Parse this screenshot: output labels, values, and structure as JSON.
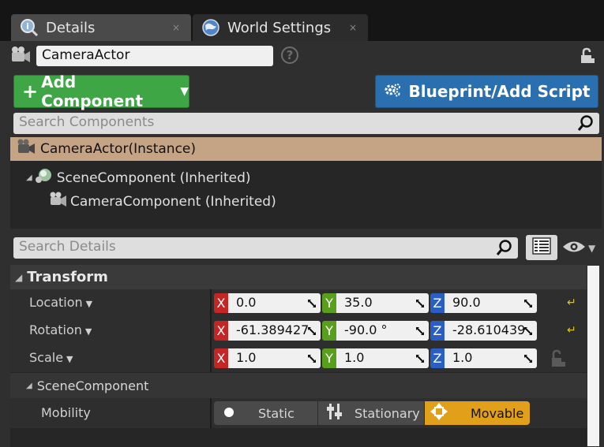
{
  "tabs": [
    {
      "label": "Details",
      "close": "×"
    },
    {
      "label": "World Settings",
      "close": "×"
    }
  ],
  "actor": {
    "name": "CameraActor",
    "help": "?"
  },
  "buttons": {
    "add_component": {
      "plus": "+",
      "label": "Add Component"
    },
    "blueprint": {
      "label": "Blueprint/Add Script"
    }
  },
  "search_components": {
    "placeholder": "Search Components"
  },
  "tree": {
    "root": "CameraActor(Instance)",
    "children": [
      {
        "label": "SceneComponent (Inherited)"
      },
      {
        "label": "CameraComponent (Inherited)"
      }
    ]
  },
  "search_details": {
    "placeholder": "Search Details"
  },
  "transform": {
    "title": "Transform",
    "rows": [
      {
        "label": "Location",
        "x": "0.0",
        "y": "35.0",
        "z": "90.0"
      },
      {
        "label": "Rotation",
        "x": "-61.389427",
        "y": "-90.0 °",
        "z": "-28.610439"
      },
      {
        "label": "Scale",
        "x": "1.0",
        "y": "1.0",
        "z": "1.0"
      }
    ],
    "axes": {
      "x": "X",
      "y": "Y",
      "z": "Z"
    }
  },
  "scene_component": {
    "title": "SceneComponent",
    "mobility_label": "Mobility",
    "options": [
      "Static",
      "Stationary",
      "Movable"
    ],
    "selected": "Movable"
  },
  "colors": {
    "add_green": "#3ea644",
    "blueprint_blue": "#2a6faf",
    "selected_row": "#c5a485",
    "movable_active": "#e0a01a",
    "axis_x": "#c42525",
    "axis_y": "#5a9e1d",
    "axis_z": "#2a5ec2"
  },
  "icons": [
    "magnifier-tab-icon",
    "globe-icon",
    "camera-actor-icon",
    "help-icon",
    "unlock-icon",
    "blueprint-gear-icon",
    "search-icon",
    "scene-component-icon",
    "camera-component-icon",
    "grid-view-icon",
    "eye-icon",
    "reset-arrow-icon",
    "scale-lock-icon",
    "static-icon",
    "stationary-icon",
    "movable-icon"
  ]
}
